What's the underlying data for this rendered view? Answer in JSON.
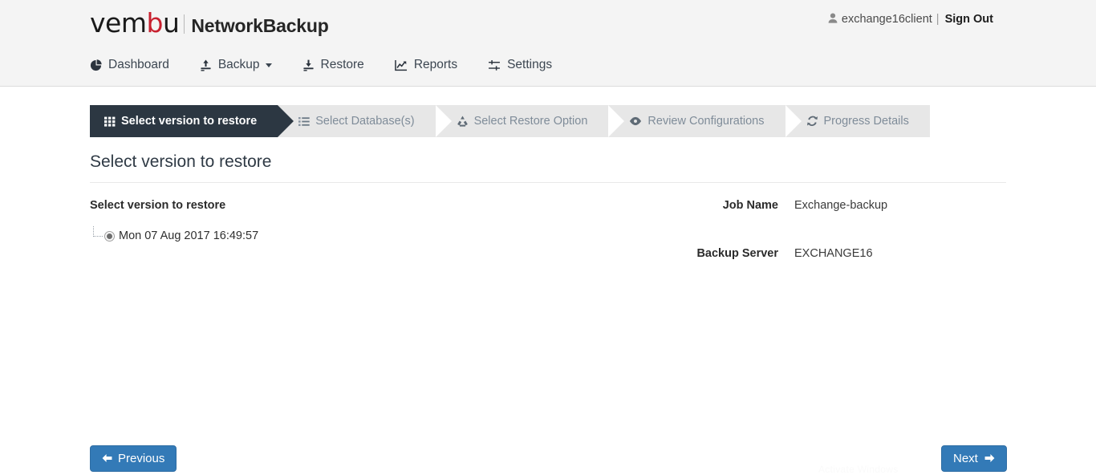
{
  "header": {
    "logo_text_1": "vem",
    "logo_text_red": "b",
    "logo_text_2": "u",
    "product_name": "NetworkBackup",
    "user_icon": "user-icon",
    "username": "exchange16client",
    "separator": "|",
    "sign_out": "Sign Out"
  },
  "nav": {
    "items": [
      {
        "label": "Dashboard",
        "icon": "pie-chart-icon",
        "has_caret": false
      },
      {
        "label": "Backup",
        "icon": "upload-icon",
        "has_caret": true
      },
      {
        "label": "Restore",
        "icon": "download-icon",
        "has_caret": false
      },
      {
        "label": "Reports",
        "icon": "line-chart-icon",
        "has_caret": false
      },
      {
        "label": "Settings",
        "icon": "sliders-icon",
        "has_caret": false
      }
    ]
  },
  "steps": [
    {
      "label": "Select version to restore",
      "icon": "grid-icon",
      "active": true
    },
    {
      "label": "Select Database(s)",
      "icon": "list-icon",
      "active": false
    },
    {
      "label": "Select Restore Option",
      "icon": "recycle-icon",
      "active": false
    },
    {
      "label": "Review Configurations",
      "icon": "eye-icon",
      "active": false
    },
    {
      "label": "Progress Details",
      "icon": "refresh-icon",
      "active": false
    }
  ],
  "main": {
    "page_title": "Select version to restore",
    "section_label": "Select version to restore",
    "versions": [
      {
        "label": "Mon 07 Aug 2017 16:49:57",
        "selected": true
      }
    ],
    "details": [
      {
        "label": "Job Name",
        "value": "Exchange-backup"
      },
      {
        "label": "Backup Server",
        "value": "EXCHANGE16"
      }
    ]
  },
  "footer": {
    "previous_label": "Previous",
    "previous_icon": "arrow-left-icon",
    "next_label": "Next",
    "next_icon": "arrow-right-icon",
    "watermark": "Activate Windows"
  },
  "colors": {
    "accent_blue": "#337ab7",
    "step_active": "#2c3742",
    "step_inactive": "#e7e7e7",
    "logo_red": "#c8202f"
  }
}
